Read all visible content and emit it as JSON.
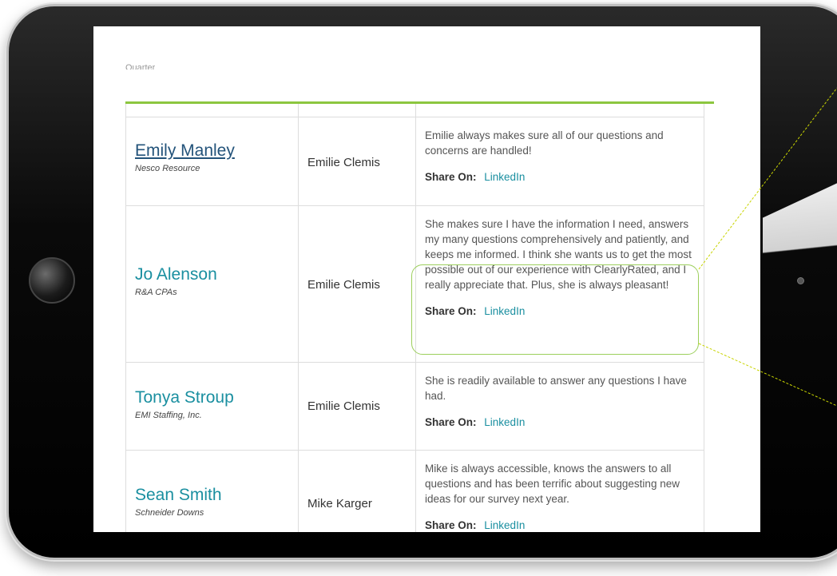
{
  "header": {
    "quarter_label": "Quarter"
  },
  "rows": [
    {
      "name": "Emily Manley",
      "company": "Nesco Resource",
      "rep": "Emilie Clemis",
      "review": "Emilie always makes sure all of our questions and concerns are handled!",
      "share_label": "Share On:",
      "share_link": "LinkedIn"
    },
    {
      "name": "Jo Alenson",
      "company": "R&A CPAs",
      "rep": "Emilie Clemis",
      "review": "She makes sure I have the information I need, answers my many questions comprehensively and patiently, and keeps me informed. I think she wants us to get the most possible out of our experience with ClearlyRated, and I really appreciate that. Plus, she is always pleasant!",
      "share_label": "Share On:",
      "share_link": "LinkedIn"
    },
    {
      "name": "Tonya Stroup",
      "company": "EMI Staffing, Inc.",
      "rep": "Emilie Clemis",
      "review": "She is readily available to answer any questions I have had.",
      "share_label": "Share On:",
      "share_link": "LinkedIn"
    },
    {
      "name": "Sean Smith",
      "company": "Schneider Downs",
      "rep": "Mike Karger",
      "review": "Mike is always accessible, knows the answers to all questions and has been terrific about suggesting new ideas for our survey next year.",
      "share_label": "Share On:",
      "share_link": "LinkedIn"
    }
  ],
  "colors": {
    "accent_green": "#8cc63f",
    "name_teal": "#1a8fa0",
    "name_link_blue": "#23537a"
  }
}
